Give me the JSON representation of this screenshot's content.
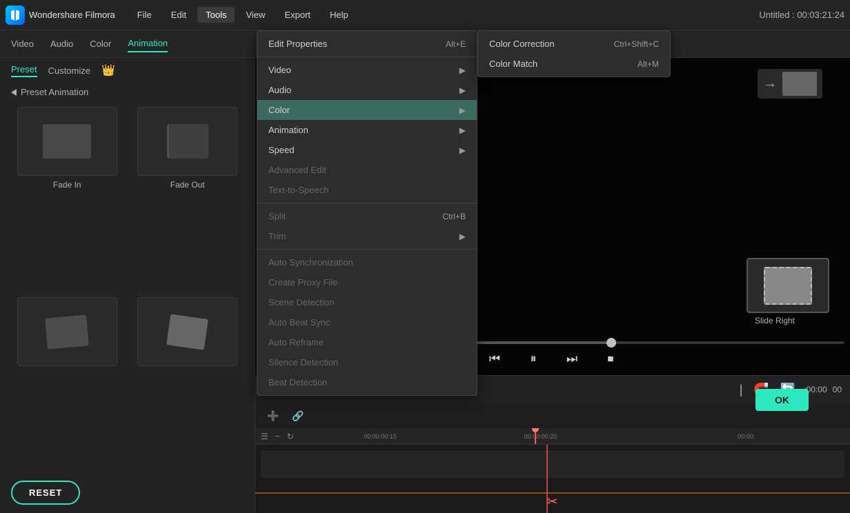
{
  "app": {
    "logo_text": "Wondershare Filmora",
    "title": "Untitled : 00:03:21:24"
  },
  "menubar": {
    "items": [
      "File",
      "Edit",
      "Tools",
      "View",
      "Export",
      "Help"
    ],
    "active": "Tools"
  },
  "tabs": {
    "items": [
      "Video",
      "Audio",
      "Color",
      "Animation"
    ],
    "active": "Animation"
  },
  "presetPanel": {
    "tabs": [
      "Preset",
      "Customize"
    ],
    "active": "Preset",
    "section_label": "Preset Animation",
    "items": [
      {
        "name": "Fade In"
      },
      {
        "name": "Fade Out"
      },
      {
        "name": ""
      },
      {
        "name": ""
      }
    ],
    "reset_label": "RESET"
  },
  "slideRight": {
    "label": "Slide Right"
  },
  "playback": {
    "ok_label": "OK"
  },
  "timeline": {
    "time_display": ":00:00",
    "markers": [
      "00:00:00:15",
      "00:00:00:20",
      "00:00:"
    ],
    "icons": [
      "grid",
      "wave",
      "rotate"
    ]
  },
  "toolsMenu": {
    "items": [
      {
        "label": "Edit Properties",
        "shortcut": "Alt+E",
        "hasArrow": false,
        "disabled": false
      },
      {
        "divider": true
      },
      {
        "label": "Video",
        "shortcut": "",
        "hasArrow": true,
        "disabled": false
      },
      {
        "label": "Audio",
        "shortcut": "",
        "hasArrow": true,
        "disabled": false
      },
      {
        "label": "Color",
        "shortcut": "",
        "hasArrow": true,
        "disabled": false,
        "highlighted": true
      },
      {
        "label": "Animation",
        "shortcut": "",
        "hasArrow": true,
        "disabled": false
      },
      {
        "label": "Speed",
        "shortcut": "",
        "hasArrow": true,
        "disabled": false
      },
      {
        "label": "Advanced Edit",
        "shortcut": "",
        "hasArrow": false,
        "disabled": true
      },
      {
        "label": "Text-to-Speech",
        "shortcut": "",
        "hasArrow": false,
        "disabled": true
      },
      {
        "divider": true
      },
      {
        "label": "Split",
        "shortcut": "Ctrl+B",
        "hasArrow": false,
        "disabled": true
      },
      {
        "label": "Trim",
        "shortcut": "",
        "hasArrow": true,
        "disabled": true
      },
      {
        "divider": true
      },
      {
        "label": "Auto Synchronization",
        "shortcut": "",
        "hasArrow": false,
        "disabled": true
      },
      {
        "label": "Create Proxy File",
        "shortcut": "",
        "hasArrow": false,
        "disabled": true
      },
      {
        "label": "Scene Detection",
        "shortcut": "",
        "hasArrow": false,
        "disabled": true
      },
      {
        "label": "Auto Beat Sync",
        "shortcut": "",
        "hasArrow": false,
        "disabled": true
      },
      {
        "label": "Auto Reframe",
        "shortcut": "",
        "hasArrow": false,
        "disabled": true
      },
      {
        "label": "Silence Detection",
        "shortcut": "",
        "hasArrow": false,
        "disabled": true
      },
      {
        "label": "Beat Detection",
        "shortcut": "",
        "hasArrow": false,
        "disabled": true
      }
    ]
  },
  "colorSubMenu": {
    "items": [
      {
        "label": "Color Correction",
        "shortcut": "Ctrl+Shift+C"
      },
      {
        "label": "Color Match",
        "shortcut": "Alt+M"
      }
    ]
  }
}
